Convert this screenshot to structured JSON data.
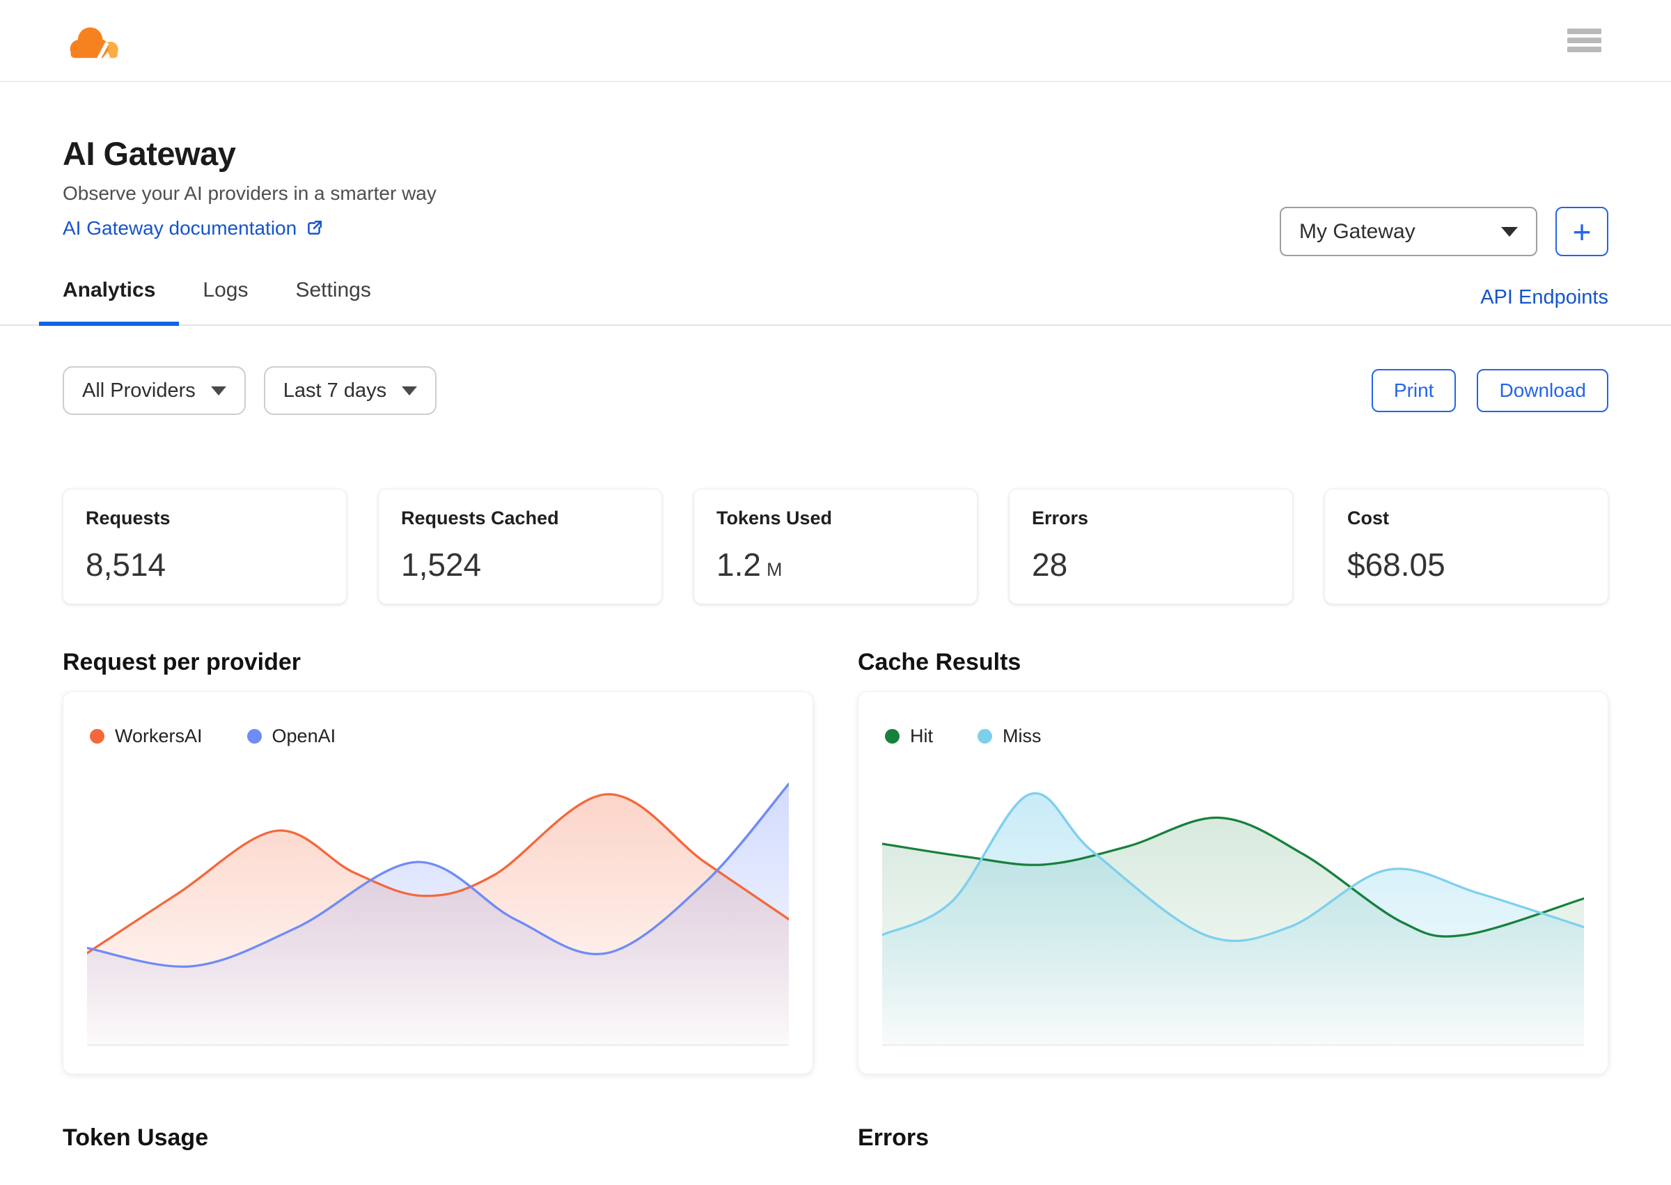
{
  "header": {
    "title": "AI Gateway",
    "subtitle": "Observe your AI providers in a smarter way",
    "doc_link": "AI Gateway documentation",
    "gateway_selector": {
      "value": "My Gateway"
    },
    "add_gateway_label": "+"
  },
  "tabs": {
    "items": [
      {
        "label": "Analytics",
        "active": true
      },
      {
        "label": "Logs",
        "active": false
      },
      {
        "label": "Settings",
        "active": false
      }
    ],
    "api_endpoints_link": "API Endpoints"
  },
  "filters": {
    "providers": "All Providers",
    "date_range": "Last 7 days",
    "print_label": "Print",
    "download_label": "Download"
  },
  "stats": [
    {
      "label": "Requests",
      "value": "8,514",
      "suffix": ""
    },
    {
      "label": "Requests Cached",
      "value": "1,524",
      "suffix": ""
    },
    {
      "label": "Tokens Used",
      "value": "1.2",
      "suffix": "M"
    },
    {
      "label": "Errors",
      "value": "28",
      "suffix": ""
    },
    {
      "label": "Cost",
      "value": "$68.05",
      "suffix": ""
    }
  ],
  "sections": {
    "requests_title": "Request per provider",
    "cache_title": "Cache Results",
    "token_usage_title": "Token Usage",
    "errors_title": "Errors"
  },
  "colors": {
    "accent_blue": "#2264EA",
    "link_blue": "#1454CB",
    "tab_underline": "#1063E6",
    "workersai_orange": "#F4683C",
    "openai_blue": "#6E8BF7",
    "hit_green": "#16813C",
    "miss_blue": "#7DD0EC"
  },
  "chart_data": [
    {
      "type": "area",
      "title": "Request per provider",
      "xlabel": "time over selected range (Last 7 days, unlabeled axis)",
      "ylabel": "requests (unlabeled axis, relative 0-100)",
      "grid": false,
      "legend_position": "top-left",
      "series": [
        {
          "name": "WorkersAI",
          "color": "#F4683C",
          "fill_opacity": 0.3,
          "points": [
            [
              0,
              35
            ],
            [
              13,
              58
            ],
            [
              27,
              82
            ],
            [
              38,
              66
            ],
            [
              48,
              57
            ],
            [
              58,
              65
            ],
            [
              74,
              96
            ],
            [
              88,
              70
            ],
            [
              100,
              48
            ]
          ]
        },
        {
          "name": "OpenAI",
          "color": "#6E8BF7",
          "fill_opacity": 0.32,
          "points": [
            [
              0,
              37
            ],
            [
              15,
              30
            ],
            [
              30,
              45
            ],
            [
              47,
              70
            ],
            [
              61,
              48
            ],
            [
              74,
              35
            ],
            [
              88,
              62
            ],
            [
              100,
              100
            ]
          ]
        }
      ]
    },
    {
      "type": "area",
      "title": "Cache Results",
      "xlabel": "time over selected range (Last 7 days, unlabeled axis)",
      "ylabel": "cache results (unlabeled axis, relative 0-100)",
      "grid": false,
      "legend_position": "top-left",
      "series": [
        {
          "name": "Hit",
          "color": "#16813C",
          "fill_opacity": 0.2,
          "points": [
            [
              0,
              77
            ],
            [
              12,
              72
            ],
            [
              23,
              69
            ],
            [
              35,
              76
            ],
            [
              48,
              87
            ],
            [
              60,
              73
            ],
            [
              74,
              47
            ],
            [
              83,
              42
            ],
            [
              100,
              56
            ]
          ]
        },
        {
          "name": "Miss",
          "color": "#7DD0EC",
          "fill_opacity": 0.45,
          "points": [
            [
              0,
              42
            ],
            [
              10,
              55
            ],
            [
              21,
              96
            ],
            [
              30,
              74
            ],
            [
              46,
              42
            ],
            [
              58,
              45
            ],
            [
              72,
              67
            ],
            [
              85,
              58
            ],
            [
              100,
              45
            ]
          ]
        }
      ]
    }
  ]
}
